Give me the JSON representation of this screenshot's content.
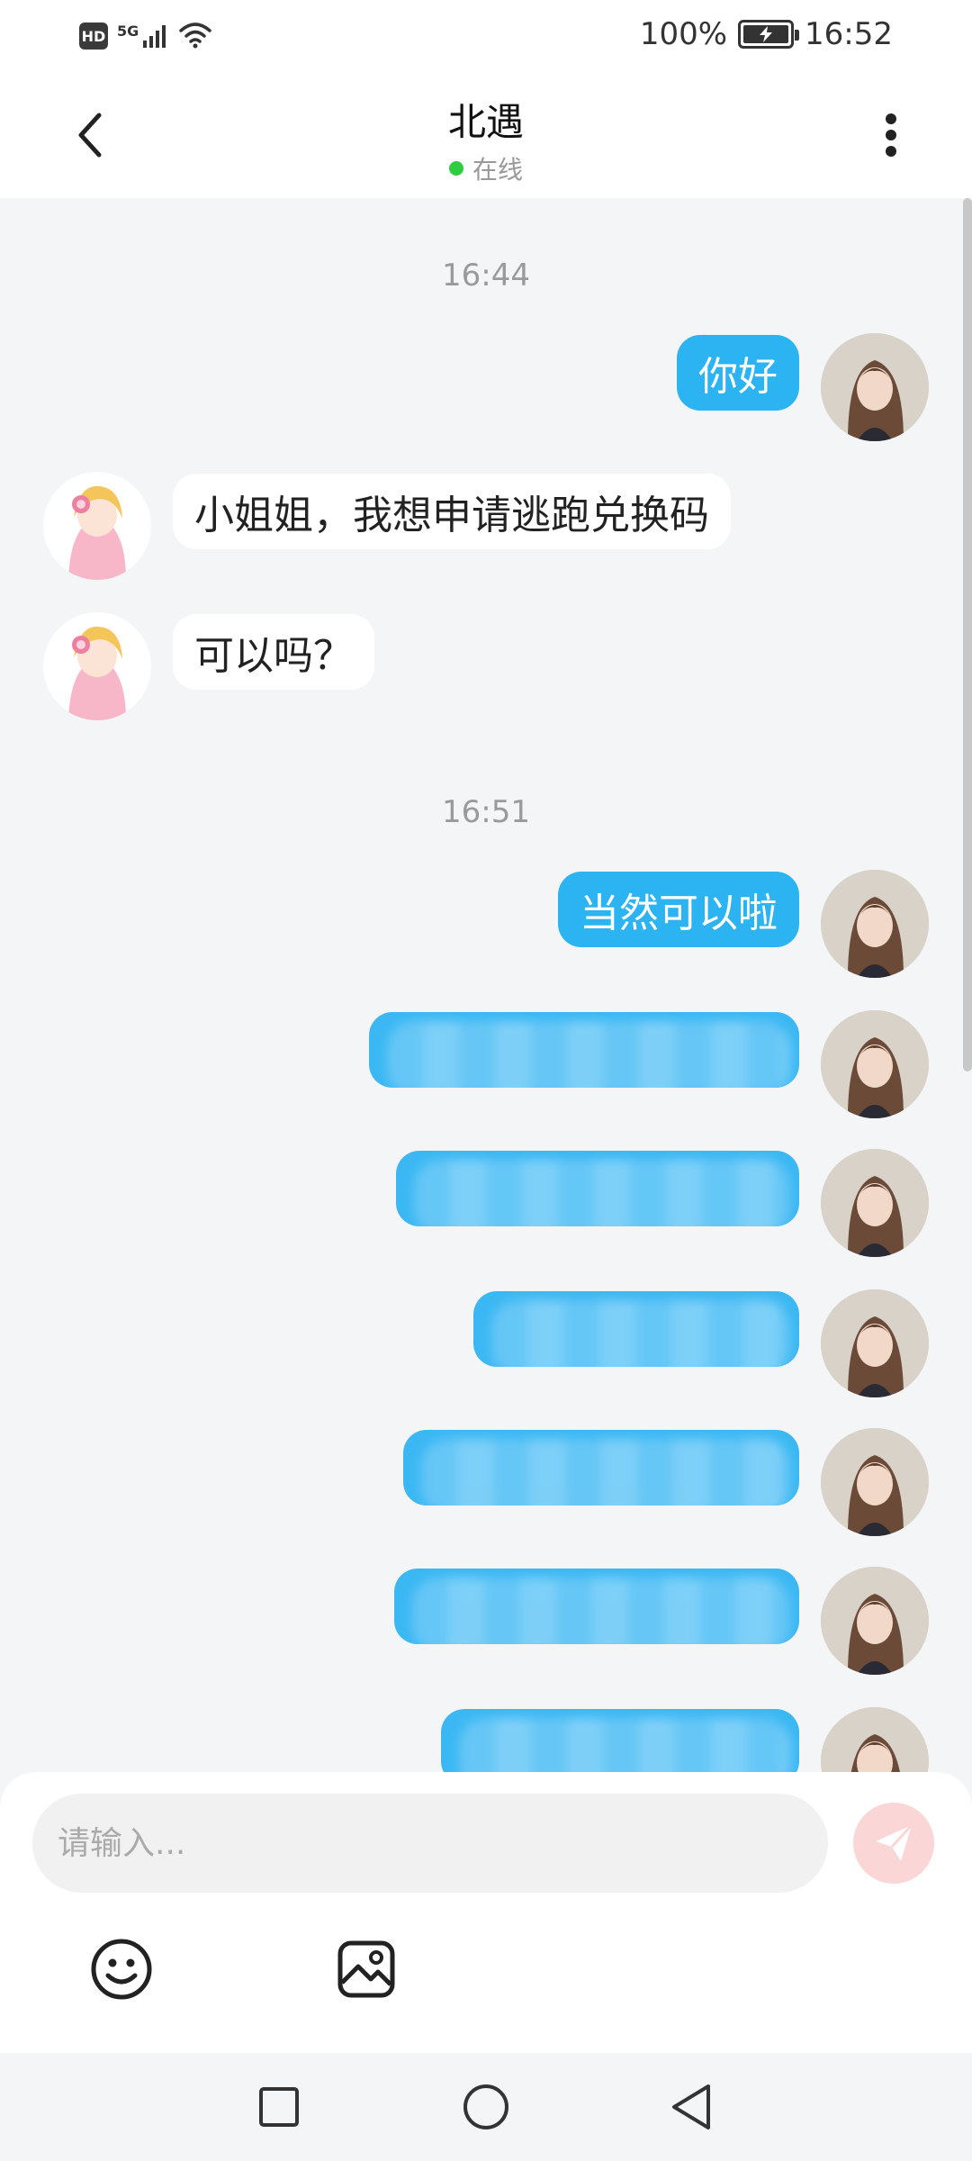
{
  "status_bar": {
    "network": "5G",
    "hd_badge": "HD",
    "battery_percent": "100%",
    "time": "16:52"
  },
  "header": {
    "title": "北遇",
    "status": "在线",
    "status_color": "#2ecc40"
  },
  "messages": {
    "timestamp_1": "16:44",
    "m1_self": "你好",
    "m2_peer": "小姐姐，我想申请逃跑兑换码",
    "m3_peer": "可以吗？",
    "timestamp_2": "16:51",
    "m4_self": "当然可以啦"
  },
  "input": {
    "placeholder": "请输入..."
  },
  "icons": {
    "back": "chevron-left-icon",
    "more": "more-vertical-icon",
    "emoji": "smiley-icon",
    "image": "image-icon",
    "send": "paper-plane-icon"
  },
  "colors": {
    "self_bubble": "#2cb3f2",
    "peer_bubble": "#ffffff",
    "background": "#f4f5f7",
    "send_button": "#fbd6d6"
  }
}
